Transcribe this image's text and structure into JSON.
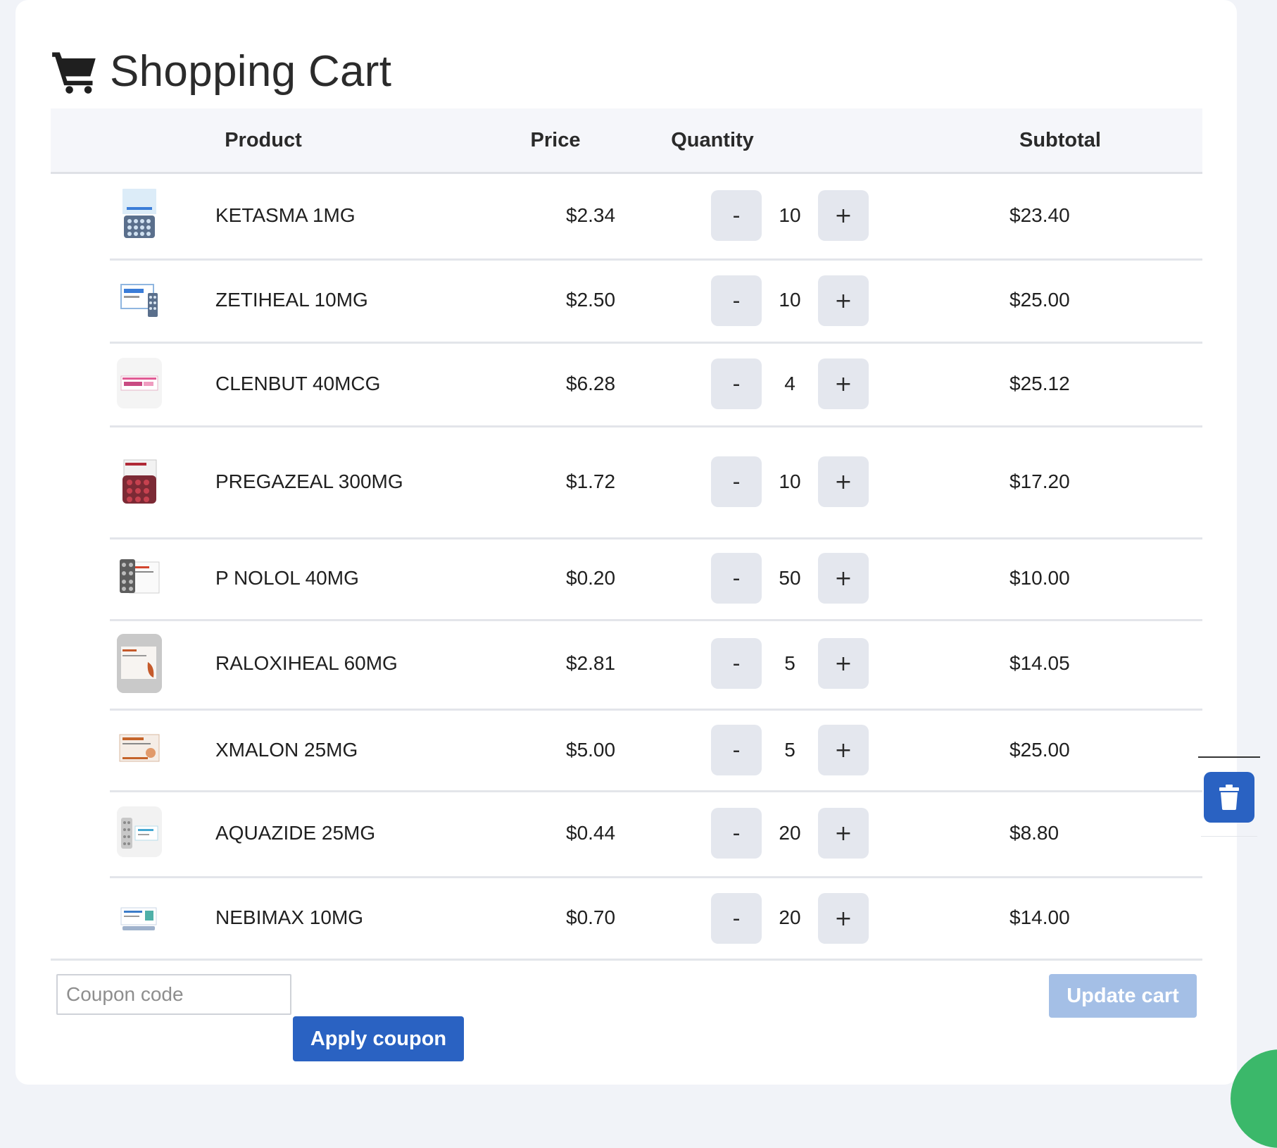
{
  "page": {
    "title": "Shopping Cart",
    "title_icon": "shopping-cart-icon"
  },
  "table": {
    "headers": {
      "product": "Product",
      "price": "Price",
      "quantity": "Quantity",
      "subtotal": "Subtotal"
    },
    "decrement_label": "-",
    "increment_label": "+",
    "items": [
      {
        "name": "KETASMA 1MG",
        "price": "$2.34",
        "qty": "10",
        "subtotal": "$23.40"
      },
      {
        "name": "ZETIHEAL 10MG",
        "price": "$2.50",
        "qty": "10",
        "subtotal": "$25.00"
      },
      {
        "name": "CLENBUT 40MCG",
        "price": "$6.28",
        "qty": "4",
        "subtotal": "$25.12"
      },
      {
        "name": "PREGAZEAL 300MG",
        "price": "$1.72",
        "qty": "10",
        "subtotal": "$17.20"
      },
      {
        "name": "P NOLOL 40MG",
        "price": "$0.20",
        "qty": "50",
        "subtotal": "$10.00"
      },
      {
        "name": "RALOXIHEAL 60MG",
        "price": "$2.81",
        "qty": "5",
        "subtotal": "$14.05"
      },
      {
        "name": "XMALON 25MG",
        "price": "$5.00",
        "qty": "5",
        "subtotal": "$25.00"
      },
      {
        "name": "AQUAZIDE 25MG",
        "price": "$0.44",
        "qty": "20",
        "subtotal": "$8.80"
      },
      {
        "name": "NEBIMAX 10MG",
        "price": "$0.70",
        "qty": "20",
        "subtotal": "$14.00"
      }
    ]
  },
  "coupon": {
    "placeholder": "Coupon code",
    "value": "",
    "apply_label": "Apply coupon"
  },
  "actions": {
    "update_label": "Update cart",
    "remove_icon": "trash-icon"
  },
  "colors": {
    "primary": "#2a62c2",
    "primary_disabled": "#a4bfe6",
    "qty_button": "#e4e7ee",
    "header_bg": "#f5f6fa",
    "page_bg": "#f1f3f8",
    "accent_green": "#3bb86a"
  }
}
